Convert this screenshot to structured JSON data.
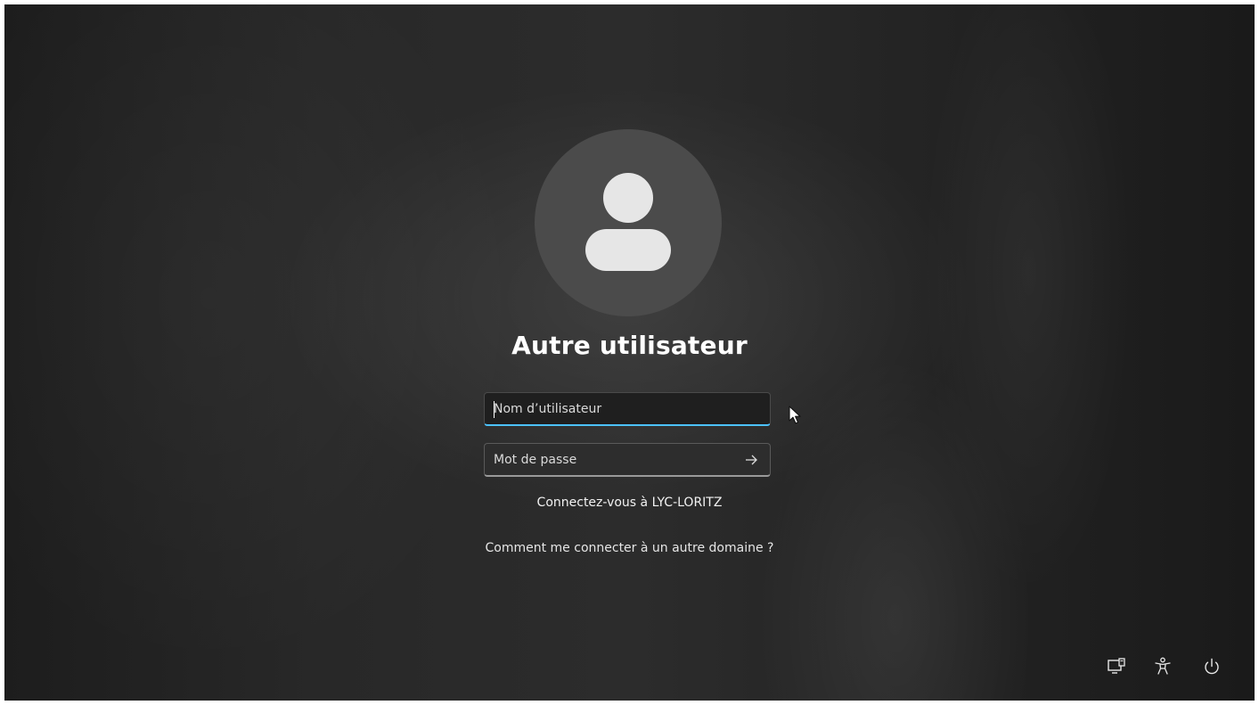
{
  "login": {
    "title": "Autre utilisateur",
    "username_placeholder": "Nom d’utilisateur",
    "username_value": "",
    "password_placeholder": "Mot de passe",
    "password_value": "",
    "submit_icon": "arrow-right-icon",
    "signin_to": "Connectez-vous à LYC-LORITZ",
    "other_domain_link": "Comment me connecter à un autre domaine ?"
  },
  "tray": {
    "icons": [
      "network-icon",
      "accessibility-icon",
      "power-icon"
    ]
  },
  "colors": {
    "accent": "#4cc2ff",
    "avatar_circle": "#4b4b4b",
    "avatar_glyph": "#e6e6e6"
  }
}
